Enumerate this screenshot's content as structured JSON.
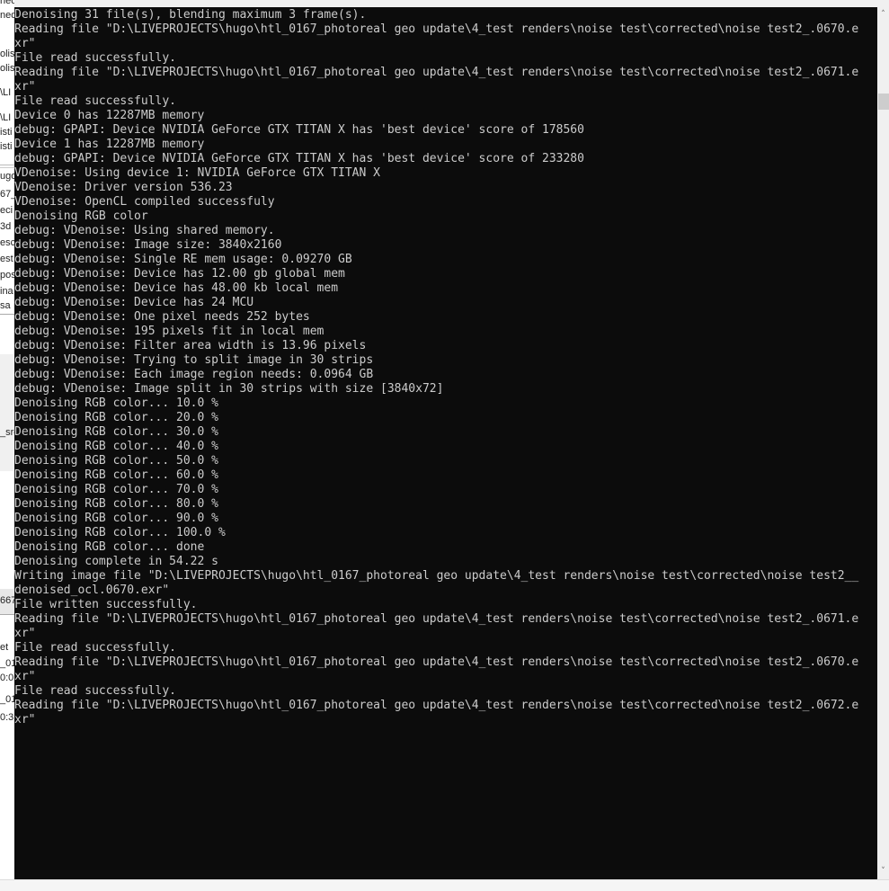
{
  "background_fragments": [
    "ned",
    "ned",
    "olis",
    "olis",
    "\\LI",
    "\\LI",
    "isti",
    "isti",
    "ugo",
    "67_",
    "eci",
    "3d",
    "esc",
    "est",
    "pos",
    "ina",
    "sa",
    "_src",
    "667,",
    "et",
    "_01",
    "0:0",
    "_01",
    "0:3"
  ],
  "console": {
    "lines": [
      "Denoising 31 file(s), blending maximum 3 frame(s).",
      "Reading file \"D:\\LIVEPROJECTS\\hugo\\htl_0167_photoreal geo update\\4_test renders\\noise test\\corrected\\noise test2_.0670.e",
      "xr\"",
      "File read successfully.",
      "Reading file \"D:\\LIVEPROJECTS\\hugo\\htl_0167_photoreal geo update\\4_test renders\\noise test\\corrected\\noise test2_.0671.e",
      "xr\"",
      "File read successfully.",
      "Device 0 has 12287MB memory",
      "debug: GPAPI: Device NVIDIA GeForce GTX TITAN X has 'best device' score of 178560",
      "Device 1 has 12287MB memory",
      "debug: GPAPI: Device NVIDIA GeForce GTX TITAN X has 'best device' score of 233280",
      "VDenoise: Using device 1: NVIDIA GeForce GTX TITAN X",
      "VDenoise: Driver version 536.23",
      "VDenoise: OpenCL compiled successfuly",
      "Denoising RGB color",
      "debug: VDenoise: Using shared memory.",
      "debug: VDenoise: Image size: 3840x2160",
      "debug: VDenoise: Single RE mem usage: 0.09270 GB",
      "debug: VDenoise: Device has 12.00 gb global mem",
      "debug: VDenoise: Device has 48.00 kb local mem",
      "debug: VDenoise: Device has 24 MCU",
      "debug: VDenoise: One pixel needs 252 bytes",
      "debug: VDenoise: 195 pixels fit in local mem",
      "debug: VDenoise: Filter area width is 13.96 pixels",
      "debug: VDenoise: Trying to split image in 30 strips",
      "debug: VDenoise: Each image region needs: 0.0964 GB",
      "debug: VDenoise: Image split in 30 strips with size [3840x72]",
      "Denoising RGB color... 10.0 %",
      "Denoising RGB color... 20.0 %",
      "Denoising RGB color... 30.0 %",
      "Denoising RGB color... 40.0 %",
      "Denoising RGB color... 50.0 %",
      "Denoising RGB color... 60.0 %",
      "Denoising RGB color... 70.0 %",
      "Denoising RGB color... 80.0 %",
      "Denoising RGB color... 90.0 %",
      "Denoising RGB color... 100.0 %",
      "Denoising RGB color... done",
      "Denoising complete in 54.22 s",
      "Writing image file \"D:\\LIVEPROJECTS\\hugo\\htl_0167_photoreal geo update\\4_test renders\\noise test\\corrected\\noise test2__",
      "denoised_ocl.0670.exr\"",
      "File written successfully.",
      "Reading file \"D:\\LIVEPROJECTS\\hugo\\htl_0167_photoreal geo update\\4_test renders\\noise test\\corrected\\noise test2_.0671.e",
      "xr\"",
      "File read successfully.",
      "Reading file \"D:\\LIVEPROJECTS\\hugo\\htl_0167_photoreal geo update\\4_test renders\\noise test\\corrected\\noise test2_.0670.e",
      "xr\"",
      "File read successfully.",
      "Reading file \"D:\\LIVEPROJECTS\\hugo\\htl_0167_photoreal geo update\\4_test renders\\noise test\\corrected\\noise test2_.0672.e",
      "xr\""
    ],
    "colors": {
      "background": "#0c0c0c",
      "text": "#cccccc"
    }
  },
  "scrollbar": {
    "up_icon": "chevron-up-icon",
    "down_icon": "chevron-down-icon",
    "position_fraction": 0.0
  }
}
